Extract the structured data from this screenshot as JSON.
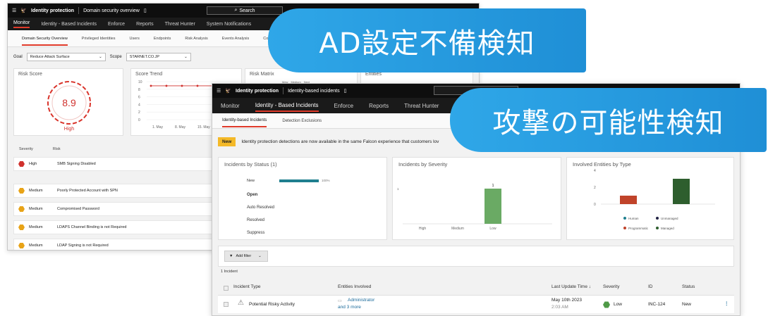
{
  "back": {
    "app_name": "Identity protection",
    "breadcrumb": "Domain security overview",
    "search_label": "Search",
    "nav": [
      "Monitor",
      "Identity - Based Incidents",
      "Enforce",
      "Reports",
      "Threat Hunter",
      "System Notifications"
    ],
    "subtabs": [
      "Domain Security Overview",
      "Privileged Identities",
      "Users",
      "Endpoints",
      "Risk Analysis",
      "Events Analysis",
      "Co"
    ],
    "goal_label": "Goal",
    "goal_value": "Reduce Attack Surface",
    "scope_label": "Scope",
    "scope_value": "STARNET.CO.JP",
    "risk_score": {
      "title": "Risk Score",
      "value": "8.9",
      "level": "High"
    },
    "score_trend": {
      "title": "Score Trend",
      "y_ticks": [
        "10",
        "8",
        "6",
        "4",
        "2",
        "0"
      ],
      "x_ticks": [
        "1. May",
        "8. May",
        "15. May",
        "2"
      ],
      "values": [
        8.9,
        8.9,
        8.9,
        8.9,
        8.9,
        8.9
      ]
    },
    "risk_matrix": {
      "title": "Risk Matrix",
      "legend": [
        "Mew",
        "Medium",
        "Next"
      ]
    },
    "entities_title": "Entities",
    "risk_headers": [
      "Severity",
      "Risk"
    ],
    "risks": [
      {
        "severity": "High",
        "risk": "SMB Signing Disabled",
        "color": "#d0312d"
      },
      {
        "severity": "Medium",
        "risk": "Poorly Protected Account with SPN",
        "color": "#e8a317"
      },
      {
        "severity": "Medium",
        "risk": "Compromised Password",
        "color": "#e8a317"
      },
      {
        "severity": "Medium",
        "risk": "LDAPS Channel Binding is not Required",
        "color": "#e8a317"
      },
      {
        "severity": "Medium",
        "risk": "LDAP Signing is not Required",
        "color": "#e8a317"
      }
    ]
  },
  "front": {
    "app_name": "Identity protection",
    "breadcrumb": "Identity-based incidents",
    "nav": [
      "Monitor",
      "Identity - Based Incidents",
      "Enforce",
      "Reports",
      "Threat Hunter",
      "S"
    ],
    "subtabs": [
      "Identity-based Incidents",
      "Detection Exclusions"
    ],
    "banner_tag": "New",
    "banner_text": "Identity protection detections are now available in the same Falcon experience that customers lov",
    "status_card": {
      "title": "Incidents by Status (1)",
      "rows": [
        "New",
        "Open",
        "Auto Resolved",
        "Resolved",
        "Suppress"
      ],
      "new_pct_label": "100%",
      "new_fraction": 1.0
    },
    "severity_card": {
      "title": "Incidents by Severity",
      "categories": [
        "High",
        "Medium",
        "Low"
      ],
      "values": [
        0,
        0,
        1
      ],
      "y_tick": "1",
      "data_label": "1"
    },
    "entities_card": {
      "title": "Involved Entities by Type",
      "y_ticks": [
        "4",
        "2",
        "0"
      ],
      "values": [
        1,
        3
      ],
      "colors": [
        "#c0432a",
        "#2e5e2e"
      ],
      "legend": [
        {
          "label": "Human",
          "color": "#1f7f8f"
        },
        {
          "label": "Unmanaged",
          "color": "#222244"
        },
        {
          "label": "Programmatic",
          "color": "#c0432a"
        },
        {
          "label": "Managed",
          "color": "#2e5e2e"
        }
      ]
    },
    "filter_label": "Add filter",
    "incident_count": "1 Incident",
    "table_headers": [
      "Incident Type",
      "Entities Involved",
      "Last Update Time ↓",
      "Severity",
      "ID",
      "Status"
    ],
    "row": {
      "type": "Potential Risky Activity",
      "entities_1": "Administrator",
      "entities_2": "and 3 more",
      "date": "May 10th 2023",
      "time": "2:03 AM",
      "severity": "Low",
      "id": "INC-124",
      "status": "New"
    }
  },
  "callouts": {
    "top": "AD設定不備検知",
    "bottom": "攻撃の可能性検知"
  }
}
